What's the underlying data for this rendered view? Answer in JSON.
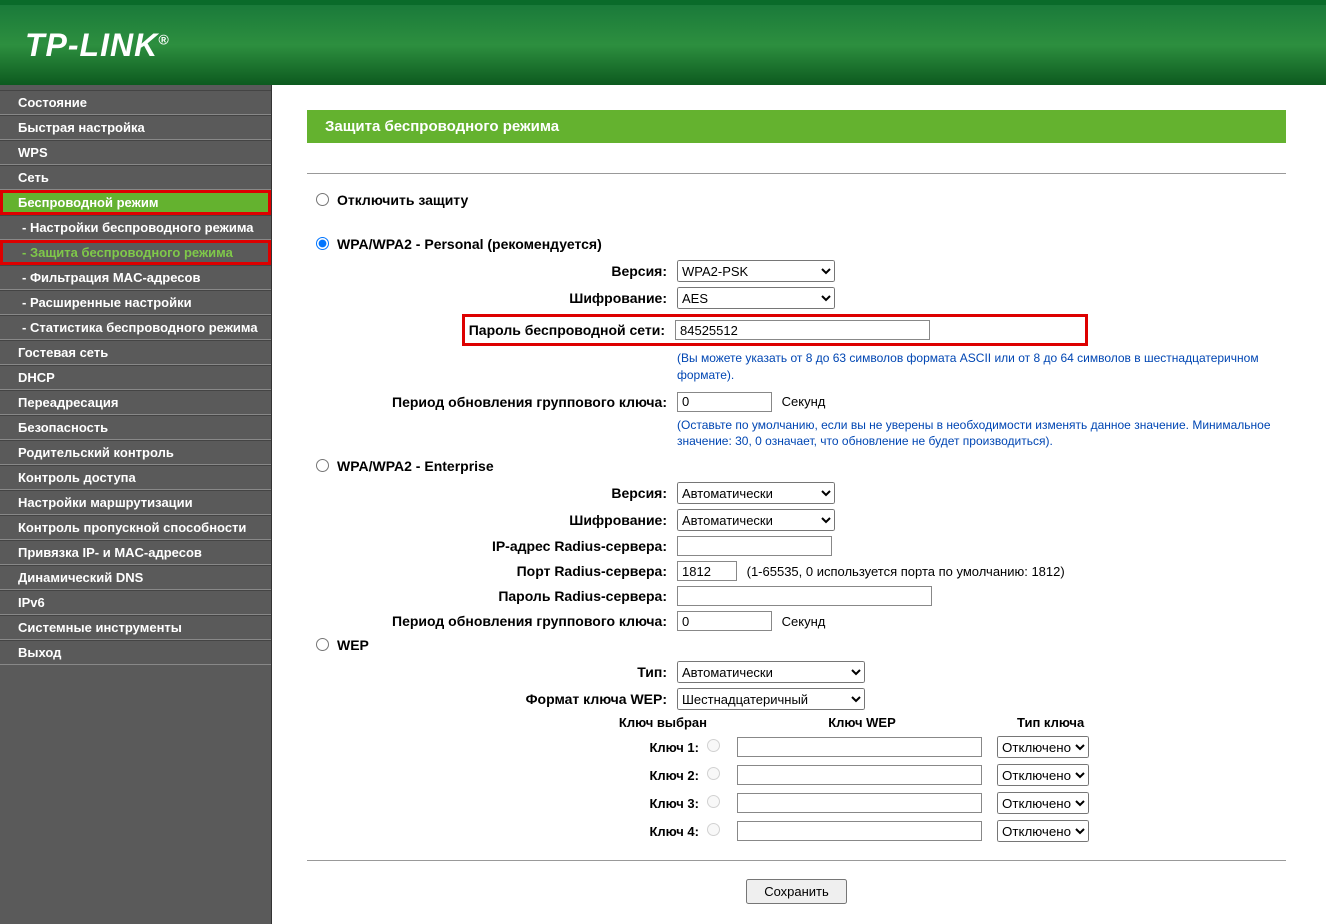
{
  "brand": "TP-LINK",
  "page_title": "Защита беспроводного режима",
  "menu": [
    {
      "label": "Состояние"
    },
    {
      "label": "Быстрая настройка"
    },
    {
      "label": "WPS"
    },
    {
      "label": "Сеть"
    },
    {
      "label": "Беспроводной режим",
      "active": true
    },
    {
      "label": "- Настройки беспроводного режима",
      "sub": true
    },
    {
      "label": "- Защита беспроводного режима",
      "sub": true,
      "active_sub": true
    },
    {
      "label": "- Фильтрация MAC-адресов",
      "sub": true
    },
    {
      "label": "- Расширенные настройки",
      "sub": true
    },
    {
      "label": "- Статистика беспроводного режима",
      "sub": true
    },
    {
      "label": "Гостевая сеть"
    },
    {
      "label": "DHCP"
    },
    {
      "label": "Переадресация"
    },
    {
      "label": "Безопасность"
    },
    {
      "label": "Родительский контроль"
    },
    {
      "label": "Контроль доступа"
    },
    {
      "label": "Настройки маршрутизации"
    },
    {
      "label": "Контроль пропускной способности"
    },
    {
      "label": "Привязка IP- и MAC-адресов"
    },
    {
      "label": "Динамический DNS"
    },
    {
      "label": "IPv6"
    },
    {
      "label": "Системные инструменты"
    },
    {
      "label": "Выход"
    }
  ],
  "security": {
    "disable_label": "Отключить защиту",
    "wpa_personal_label": "WPA/WPA2 - Personal (рекомендуется)",
    "wpa_enterprise_label": "WPA/WPA2 - Enterprise",
    "wep_label": "WEP",
    "version_label": "Версия:",
    "encryption_label": "Шифрование:",
    "password_label": "Пароль беспроводной сети:",
    "gku_label": "Период обновления группового ключа:",
    "radius_ip_label": "IP-адрес Radius-сервера:",
    "radius_port_label": "Порт Radius-сервера:",
    "radius_pw_label": "Пароль Radius-сервера:",
    "type_label": "Тип:",
    "wep_format_label": "Формат ключа WEP:",
    "key_selected_label": "Ключ выбран",
    "wep_key_label": "Ключ WEP",
    "key_type_label": "Тип ключа",
    "key_labels": [
      "Ключ 1:",
      "Ключ 2:",
      "Ключ 3:",
      "Ключ 4:"
    ],
    "seconds": "Секунд",
    "personal": {
      "version": "WPA2-PSK",
      "encryption": "AES",
      "password": "84525512",
      "gku": "0"
    },
    "enterprise": {
      "version": "Автоматически",
      "encryption": "Автоматически",
      "radius_ip": "",
      "radius_port": "1812",
      "radius_port_hint": "(1-65535, 0 используется порта по умолчанию: 1812)",
      "radius_pw": "",
      "gku": "0"
    },
    "wep": {
      "type": "Автоматически",
      "format": "Шестнадцатеричный",
      "disabled_opt": "Отключено"
    },
    "hint_password": "(Вы можете указать от 8 до 63 символов формата ASCII или от 8 до 64 символов в шестнадцатеричном формате).",
    "hint_gku": "(Оставьте по умолчанию, если вы не уверены в необходимости изменять данное значение. Минимальное значение: 30, 0 означает, что обновление не будет производиться).",
    "save_button": "Сохранить"
  }
}
